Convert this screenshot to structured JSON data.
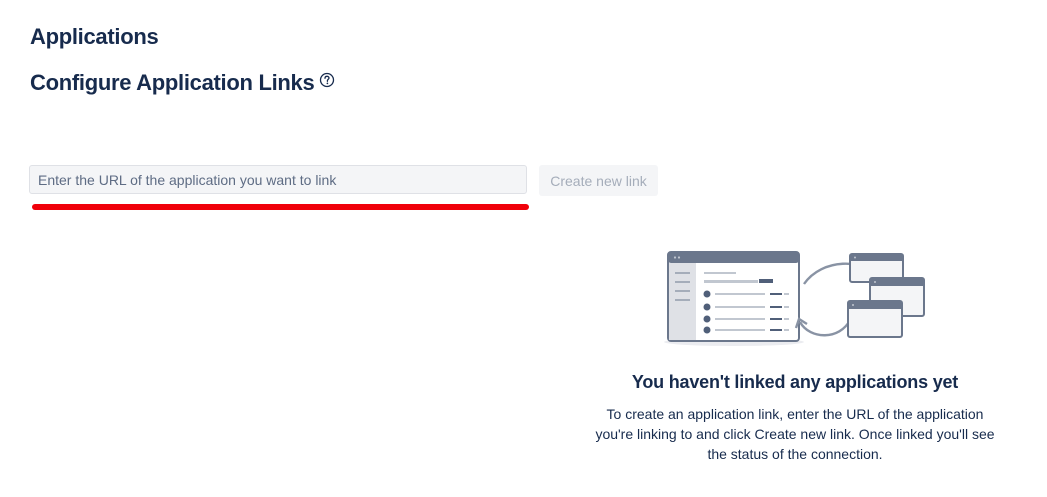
{
  "page": {
    "header": "Applications",
    "section_title": "Configure Application Links"
  },
  "link_form": {
    "url_placeholder": "Enter the URL of the application you want to link",
    "url_value": "",
    "create_button_label": "Create new link",
    "create_button_enabled": false
  },
  "empty_state": {
    "title": "You haven't linked any applications yet",
    "description": "To create an application link, enter the URL of the application you're linking to and click Create new link. Once linked you'll see the status of the connection.",
    "illustration_icon": "linked-windows-illustration"
  },
  "icons": {
    "help": "question-circle-icon"
  },
  "colors": {
    "heading_text": "#172b4d",
    "input_background": "#f4f5f7",
    "disabled_button_text": "#a5adba",
    "annotation_underline": "#f0000a"
  }
}
